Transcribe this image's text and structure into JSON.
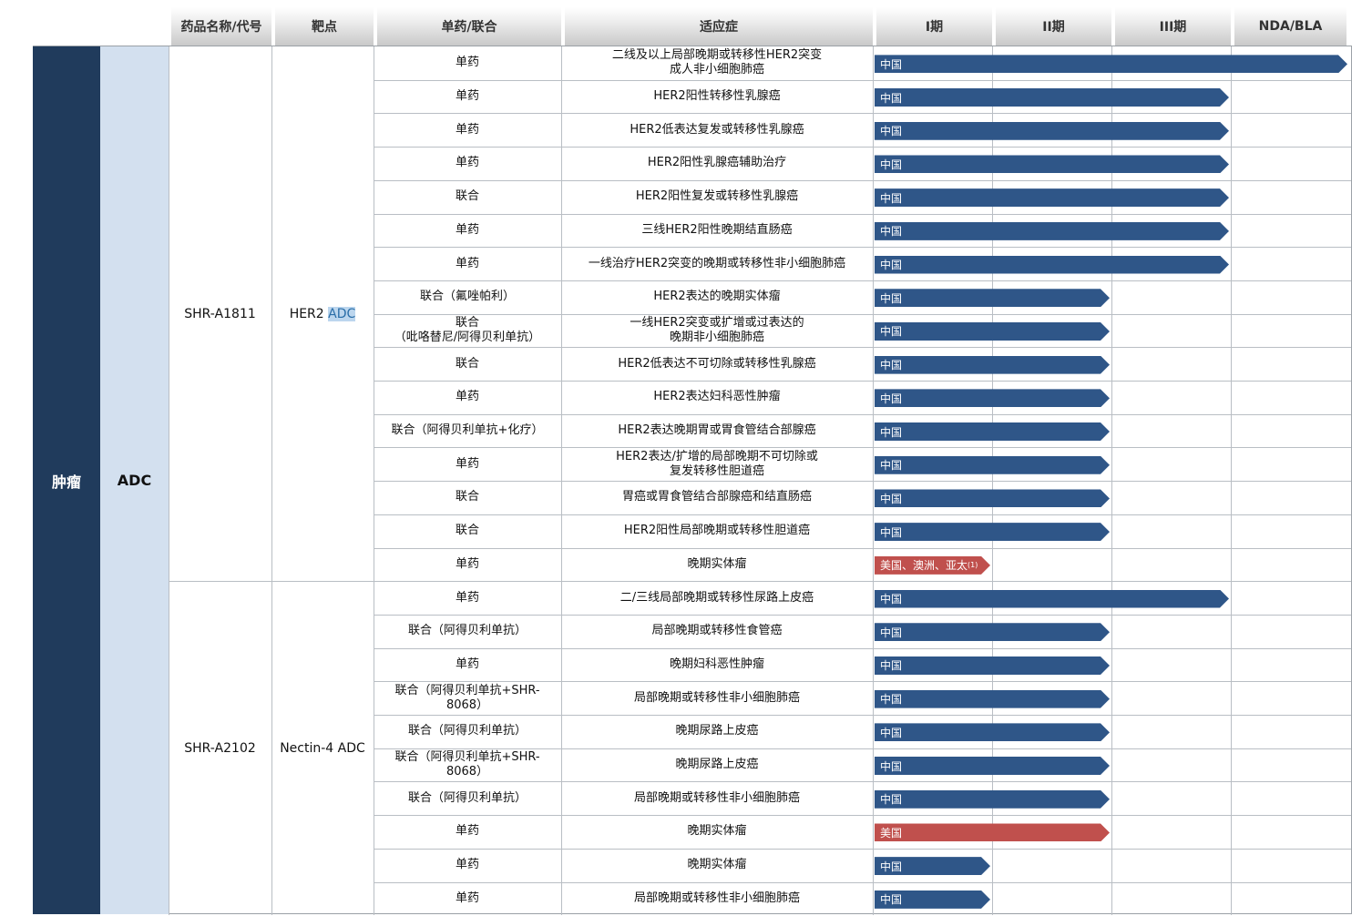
{
  "headers": [
    "药品名称/代号",
    "靶点",
    "单药/联合",
    "适应症",
    "I期",
    "II期",
    "III期",
    "NDA/BLA"
  ],
  "categories": {
    "area": "肿瘤",
    "modality": "ADC"
  },
  "colors": {
    "china": "#2f5688",
    "overseas": "#c0504d",
    "area_bg": "#203b5c",
    "modality_bg": "#d3e0ef"
  },
  "drugs": [
    {
      "name": "SHR-A1811",
      "target_prefix": "HER2 ",
      "target_highlight": "ADC"
    },
    {
      "name": "SHR-A2102",
      "target_prefix": "Nectin-4 ADC",
      "target_highlight": ""
    }
  ],
  "chart_data": {
    "type": "table",
    "phases": [
      "I期",
      "II期",
      "III期",
      "NDA/BLA"
    ],
    "rows": [
      {
        "drug": "SHR-A1811",
        "combo": "单药",
        "indication": "二线及以上局部晚期或转移性HER2突变\n成人非小细胞肺癌",
        "phase": 4.0,
        "region": "中国"
      },
      {
        "drug": "SHR-A1811",
        "combo": "单药",
        "indication": "HER2阳性转移性乳腺癌",
        "phase": 3.0,
        "region": "中国"
      },
      {
        "drug": "SHR-A1811",
        "combo": "单药",
        "indication": "HER2低表达复发或转移性乳腺癌",
        "phase": 3.0,
        "region": "中国"
      },
      {
        "drug": "SHR-A1811",
        "combo": "单药",
        "indication": "HER2阳性乳腺癌辅助治疗",
        "phase": 3.0,
        "region": "中国"
      },
      {
        "drug": "SHR-A1811",
        "combo": "联合",
        "indication": "HER2阳性复发或转移性乳腺癌",
        "phase": 3.0,
        "region": "中国"
      },
      {
        "drug": "SHR-A1811",
        "combo": "单药",
        "indication": "三线HER2阳性晚期结直肠癌",
        "phase": 3.0,
        "region": "中国"
      },
      {
        "drug": "SHR-A1811",
        "combo": "单药",
        "indication": "一线治疗HER2突变的晚期或转移性非小细胞肺癌",
        "phase": 3.0,
        "region": "中国"
      },
      {
        "drug": "SHR-A1811",
        "combo": "联合（氟唑帕利）",
        "indication": "HER2表达的晚期实体瘤",
        "phase": 2.0,
        "region": "中国"
      },
      {
        "drug": "SHR-A1811",
        "combo": "联合\n（吡咯替尼/阿得贝利单抗）",
        "indication": "一线HER2突变或扩增或过表达的\n晚期非小细胞肺癌",
        "phase": 2.0,
        "region": "中国"
      },
      {
        "drug": "SHR-A1811",
        "combo": "联合",
        "indication": "HER2低表达不可切除或转移性乳腺癌",
        "phase": 2.0,
        "region": "中国"
      },
      {
        "drug": "SHR-A1811",
        "combo": "单药",
        "indication": "HER2表达妇科恶性肿瘤",
        "phase": 2.0,
        "region": "中国"
      },
      {
        "drug": "SHR-A1811",
        "combo": "联合（阿得贝利单抗+化疗）",
        "indication": "HER2表达晚期胃或胃食管结合部腺癌",
        "phase": 2.0,
        "region": "中国"
      },
      {
        "drug": "SHR-A1811",
        "combo": "单药",
        "indication": "HER2表达/扩增的局部晚期不可切除或\n复发转移性胆道癌",
        "phase": 2.0,
        "region": "中国"
      },
      {
        "drug": "SHR-A1811",
        "combo": "联合",
        "indication": "胃癌或胃食管结合部腺癌和结直肠癌",
        "phase": 2.0,
        "region": "中国"
      },
      {
        "drug": "SHR-A1811",
        "combo": "联合",
        "indication": "HER2阳性局部晚期或转移性胆道癌",
        "phase": 2.0,
        "region": "中国"
      },
      {
        "drug": "SHR-A1811",
        "combo": "单药",
        "indication": "晚期实体瘤",
        "phase": 1.0,
        "region": "美国、澳洲、亚太",
        "footnote": "(1)"
      },
      {
        "drug": "SHR-A2102",
        "combo": "单药",
        "indication": "二/三线局部晚期或转移性尿路上皮癌",
        "phase": 3.0,
        "region": "中国"
      },
      {
        "drug": "SHR-A2102",
        "combo": "联合（阿得贝利单抗）",
        "indication": "局部晚期或转移性食管癌",
        "phase": 2.0,
        "region": "中国"
      },
      {
        "drug": "SHR-A2102",
        "combo": "单药",
        "indication": "晚期妇科恶性肿瘤",
        "phase": 2.0,
        "region": "中国"
      },
      {
        "drug": "SHR-A2102",
        "combo": "联合（阿得贝利单抗+SHR-\n8068）",
        "indication": "局部晚期或转移性非小细胞肺癌",
        "phase": 2.0,
        "region": "中国"
      },
      {
        "drug": "SHR-A2102",
        "combo": "联合（阿得贝利单抗）",
        "indication": "晚期尿路上皮癌",
        "phase": 2.0,
        "region": "中国"
      },
      {
        "drug": "SHR-A2102",
        "combo": "联合（阿得贝利单抗+SHR-\n8068）",
        "indication": "晚期尿路上皮癌",
        "phase": 2.0,
        "region": "中国"
      },
      {
        "drug": "SHR-A2102",
        "combo": "联合（阿得贝利单抗）",
        "indication": "局部晚期或转移性非小细胞肺癌",
        "phase": 2.0,
        "region": "中国"
      },
      {
        "drug": "SHR-A2102",
        "combo": "单药",
        "indication": "晚期实体瘤",
        "phase": 2.0,
        "region": "美国"
      },
      {
        "drug": "SHR-A2102",
        "combo": "单药",
        "indication": "晚期实体瘤",
        "phase": 1.0,
        "region": "中国"
      },
      {
        "drug": "SHR-A2102",
        "combo": "单药",
        "indication": "局部晚期或转移性非小细胞肺癌",
        "phase": 1.0,
        "region": "中国"
      }
    ]
  }
}
